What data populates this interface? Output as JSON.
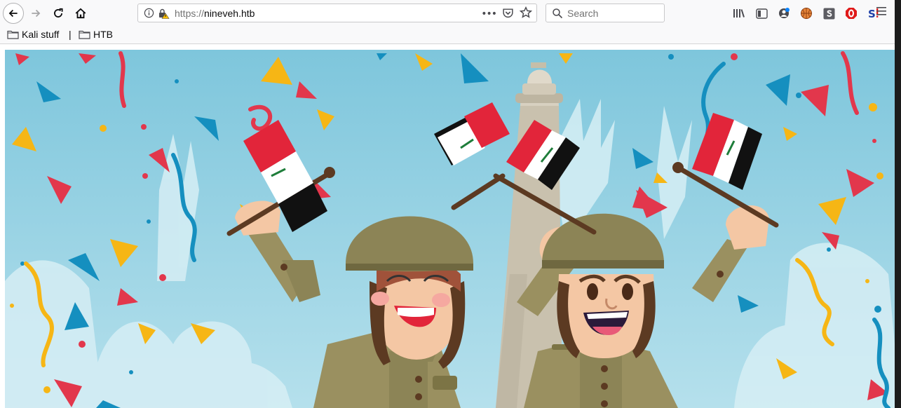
{
  "browser": {
    "url_scheme": "https://",
    "url_host": "nineveh.htb",
    "search_placeholder": "Search",
    "overflow_menu_label": "•••"
  },
  "bookmarks": [
    {
      "label": "Kali stuff"
    },
    {
      "label": "HTB"
    }
  ],
  "bookmark_separator": "|",
  "hero": {
    "colors": {
      "sky": "#8fd0e3",
      "flag_red": "#e2253a",
      "flag_black": "#111111",
      "helmet": "#8c8456",
      "uniform": "#9a9060",
      "skin": "#f4c7a4",
      "tower": "#cfc6b4"
    }
  }
}
